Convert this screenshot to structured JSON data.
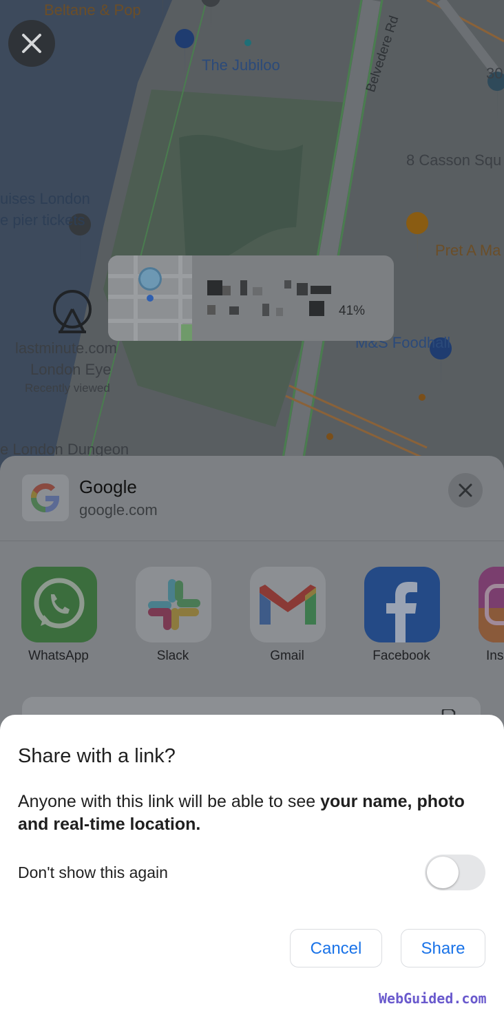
{
  "map": {
    "labels": {
      "beltane": "Beltane & Pop",
      "jubiloo": "The Jubiloo",
      "belvedere": "Belvedere Rd",
      "casson": "8 Casson Squ",
      "num30": "30",
      "cruises1": "uises London",
      "cruises2": "e pier tickets",
      "pret": "Pret A Ma",
      "ms": "M&S Foodhall",
      "lastminute": "lastminute.com",
      "londoneye": "London Eye",
      "recently": "Recently viewed",
      "dungeon": "e London Dungeon"
    }
  },
  "share_card": {
    "battery": "41%"
  },
  "sheet": {
    "app_name": "Google",
    "app_domain": "google.com",
    "apps": [
      {
        "label": "WhatsApp"
      },
      {
        "label": "Slack"
      },
      {
        "label": "Gmail"
      },
      {
        "label": "Facebook"
      },
      {
        "label": "Ins"
      }
    ]
  },
  "dialog": {
    "title": "Share with a link?",
    "body_prefix": "Anyone with this link will be able to see ",
    "body_bold": "your name, photo and real-time location.",
    "toggle_label": "Don't show this again",
    "toggle_on": false,
    "cancel_label": "Cancel",
    "share_label": "Share"
  },
  "watermark": "WebGuided.com",
  "colors": {
    "accent": "#1a73e8",
    "watermark": "#6a5acd"
  }
}
